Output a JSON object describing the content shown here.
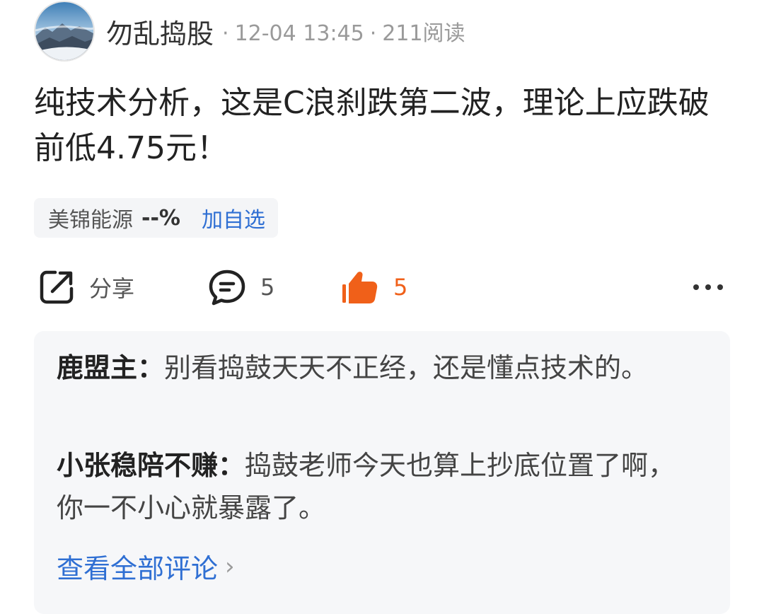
{
  "post": {
    "author": "勿乱捣股",
    "date": "12-04 13:45",
    "reads": "211阅读",
    "content": "纯技术分析，这是C浪刹跌第二波，理论上应跌破前低4.75元！"
  },
  "stock": {
    "name": "美锦能源",
    "change": "--%",
    "action_label": "加自选"
  },
  "actions": {
    "share_label": "分享",
    "comment_count": "5",
    "like_count": "5"
  },
  "comments": [
    {
      "user": "鹿盟主",
      "text": "别看捣鼓天天不正经，还是懂点技术的。"
    },
    {
      "user": "小张稳陪不赚",
      "text": "捣鼓老师今天也算上抄底位置了啊，你一不小心就暴露了。"
    }
  ],
  "view_all_label": "查看全部评论",
  "colors": {
    "accent_blue": "#2f6fd3",
    "like_orange": "#f06019",
    "muted_gray": "#9a9a9a"
  },
  "icons": [
    "mountain-avatar",
    "share-icon",
    "comment-icon",
    "thumbs-up-icon",
    "more-icon",
    "chevron-right-icon"
  ]
}
